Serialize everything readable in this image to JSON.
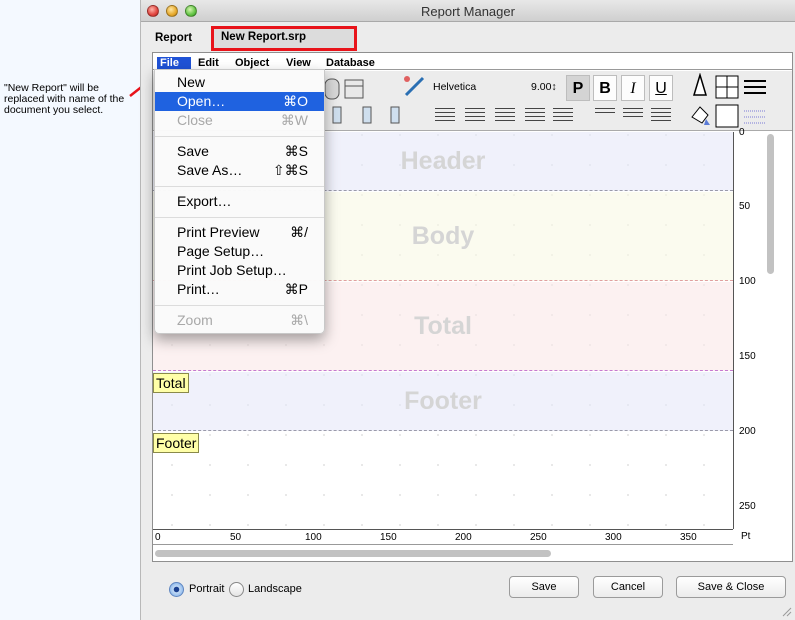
{
  "annotation": {
    "text": "\"New Report\" will be replaced with name of the document you select.",
    "arrow_color": "#e8131a"
  },
  "window": {
    "title": "Report Manager"
  },
  "tabs": {
    "report": "Report",
    "document": "New Report.srp"
  },
  "menubar": [
    "File",
    "Edit",
    "Object",
    "View",
    "Database"
  ],
  "toolbar": {
    "font_name": "Helvetica",
    "font_size": "9.00↕",
    "plain": "P",
    "bold": "B",
    "italic": "I",
    "underline": "U"
  },
  "file_menu": {
    "groups": [
      [
        {
          "label": "New",
          "shortcut": ""
        },
        {
          "label": "Open…",
          "shortcut": "⌘O",
          "highlighted": true
        },
        {
          "label": "Close",
          "shortcut": "⌘W",
          "disabled": true
        }
      ],
      [
        {
          "label": "Save",
          "shortcut": "⌘S"
        },
        {
          "label": "Save As…",
          "shortcut": "⇧⌘S"
        }
      ],
      [
        {
          "label": "Export…",
          "shortcut": ""
        }
      ],
      [
        {
          "label": "Print Preview",
          "shortcut": "⌘/"
        },
        {
          "label": "Page Setup…",
          "shortcut": ""
        },
        {
          "label": "Print Job Setup…",
          "shortcut": ""
        },
        {
          "label": "Print…",
          "shortcut": "⌘P"
        }
      ],
      [
        {
          "label": "Zoom",
          "shortcut": "⌘\\",
          "disabled": true
        }
      ]
    ]
  },
  "bands": {
    "header": "Header",
    "body": "Body",
    "total": "Total",
    "footer": "Footer"
  },
  "band_tags": {
    "total": "Total",
    "footer": "Footer"
  },
  "vruler": [
    "0",
    "50",
    "100",
    "150",
    "200",
    "250"
  ],
  "hruler": [
    "0",
    "50",
    "100",
    "150",
    "200",
    "250",
    "300",
    "350"
  ],
  "ruler_unit": "Pt",
  "orientation": {
    "portrait": "Portrait",
    "landscape": "Landscape",
    "selected": "portrait"
  },
  "buttons": {
    "save": "Save",
    "cancel": "Cancel",
    "save_close": "Save & Close"
  }
}
